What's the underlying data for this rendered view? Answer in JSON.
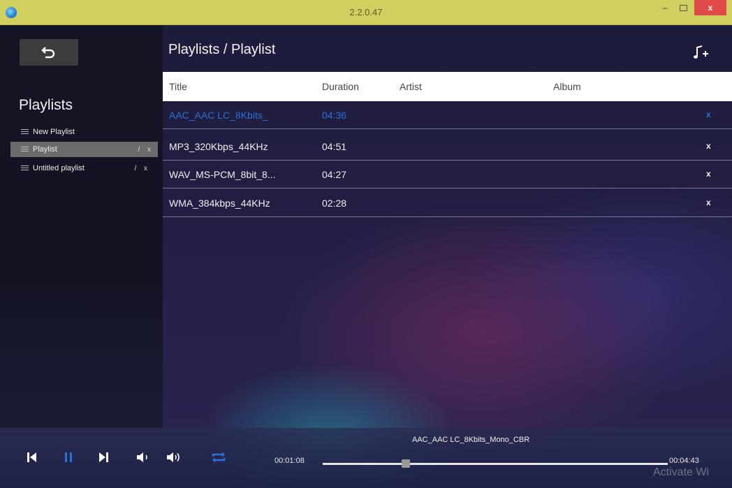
{
  "window": {
    "title": "2.2.0.47",
    "minimize": "–",
    "close": "x"
  },
  "sidebar": {
    "heading": "Playlists",
    "playlists": [
      {
        "label": "New Playlist",
        "selected": false,
        "actions": ""
      },
      {
        "label": "Playlist",
        "selected": true,
        "actions": "/ x"
      },
      {
        "label": "Untitled playlist",
        "selected": false,
        "actions": "/ x"
      }
    ]
  },
  "header": {
    "title": "Playlists / Playlist",
    "add_icon": "music-note-plus-icon"
  },
  "table": {
    "columns": {
      "title": "Title",
      "duration": "Duration",
      "artist": "Artist",
      "album": "Album"
    },
    "rows": [
      {
        "title": "AAC_AAC LC_8Kbits_",
        "duration": "04:36",
        "artist": "",
        "album": "",
        "remove": "x",
        "active": true
      },
      {
        "title": "MP3_320Kbps_44KHz",
        "duration": "04:51",
        "artist": "",
        "album": "",
        "remove": "x",
        "active": false
      },
      {
        "title": "WAV_MS-PCM_8bit_8...",
        "duration": "04:27",
        "artist": "",
        "album": "",
        "remove": "x",
        "active": false
      },
      {
        "title": "WMA_384kbps_44KHz",
        "duration": "02:28",
        "artist": "",
        "album": "",
        "remove": "x",
        "active": false
      }
    ]
  },
  "player": {
    "now_playing": "AAC_AAC LC_8Kbits_Mono_CBR",
    "current_time": "00:01:08",
    "total_time": "00:04:43",
    "progress_fraction": 0.24,
    "accent_color": "#2a72d6",
    "controls": [
      "previous-icon",
      "pause-icon",
      "next-icon",
      "volume-down-icon",
      "volume-up-icon",
      "repeat-icon"
    ]
  },
  "watermark": "Activate Wi"
}
